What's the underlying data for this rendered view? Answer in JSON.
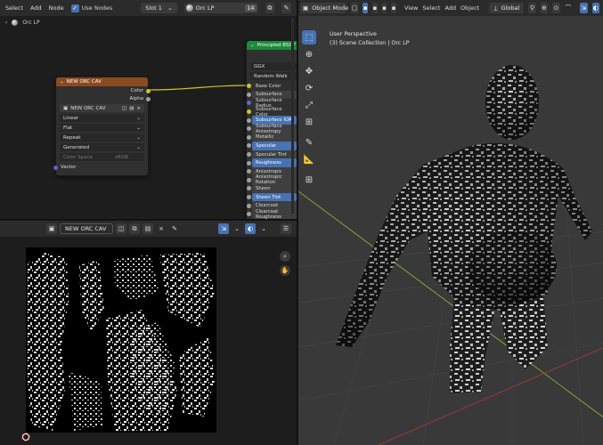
{
  "node_header": {
    "menu": [
      "Select",
      "Add",
      "Node"
    ],
    "use_nodes_label": "Use Nodes",
    "slot": "Slot 1",
    "material": "Orc LP",
    "user_count": "14"
  },
  "breadcrumb": "Orc LP",
  "image_texture_node": {
    "title": "NEW ORC CAV",
    "output_color": "Color",
    "output_alpha": "Alpha",
    "image_name": "NEW ORC CAV",
    "interpolation": "Linear",
    "projection": "Flat",
    "extension": "Repeat",
    "source": "Generated",
    "color_space_label": "Color Space",
    "color_space_value": "sRGB",
    "input_vector": "Vector"
  },
  "bsdf_node": {
    "title": "Principled BSDF",
    "distribution": "GGX",
    "subsurface_method": "Random Walk",
    "rows": [
      {
        "label": "Base Color",
        "style": "plain",
        "sock": "y"
      },
      {
        "label": "Subsurface",
        "style": "sep",
        "sock": "g"
      },
      {
        "label": "Subsurface Radius",
        "style": "plain",
        "sock": "b"
      },
      {
        "label": "Subsurface Color",
        "style": "plain",
        "sock": "y"
      },
      {
        "label": "Subsurface IOR",
        "style": "hl",
        "sock": "g"
      },
      {
        "label": "Subsurface Anisotropy",
        "style": "sep",
        "sock": "g"
      },
      {
        "label": "Metallic",
        "style": "sep",
        "sock": "g"
      },
      {
        "label": "Specular",
        "style": "hl",
        "sock": "g"
      },
      {
        "label": "Specular Tint",
        "style": "sep",
        "sock": "g"
      },
      {
        "label": "Roughness",
        "style": "hl",
        "sock": "g"
      },
      {
        "label": "Anisotropic",
        "style": "sep",
        "sock": "g"
      },
      {
        "label": "Anisotropic Rotation",
        "style": "sep",
        "sock": "g"
      },
      {
        "label": "Sheen",
        "style": "sep",
        "sock": "g"
      },
      {
        "label": "Sheen Tint",
        "style": "hl",
        "sock": "g"
      },
      {
        "label": "Clearcoat",
        "style": "sep",
        "sock": "g"
      },
      {
        "label": "Clearcoat Roughness",
        "style": "sep",
        "sock": "g"
      }
    ]
  },
  "image_editor": {
    "image_name": "NEW ORC CAV"
  },
  "viewport_header": {
    "mode": "Object Mode",
    "menu": [
      "View",
      "Select",
      "Add",
      "Object"
    ],
    "orientation": "Global"
  },
  "viewport": {
    "perspective": "User Perspective",
    "collection": "(3) Scene Collection | Orc LP"
  },
  "colors": {
    "accent": "#4772b3",
    "node_header_texture": "#8a4a1f",
    "node_header_bsdf": "#1b8a3a",
    "link": "#c7c729"
  }
}
